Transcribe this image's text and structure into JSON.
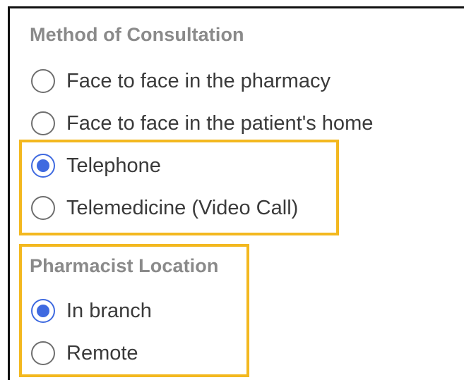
{
  "consultation": {
    "title": "Method of Consultation",
    "options": [
      {
        "label": "Face to face in the pharmacy",
        "checked": false
      },
      {
        "label": "Face to face in the patient's home",
        "checked": false
      },
      {
        "label": "Telephone",
        "checked": true
      },
      {
        "label": "Telemedicine (Video Call)",
        "checked": false
      }
    ]
  },
  "location": {
    "title": "Pharmacist Location",
    "options": [
      {
        "label": "In branch",
        "checked": true
      },
      {
        "label": "Remote",
        "checked": false
      }
    ]
  },
  "colors": {
    "accent": "#3f6ae0",
    "highlight": "#f3b81f",
    "title_gray": "#8a8a8a",
    "label_text": "#3a3a3a"
  }
}
